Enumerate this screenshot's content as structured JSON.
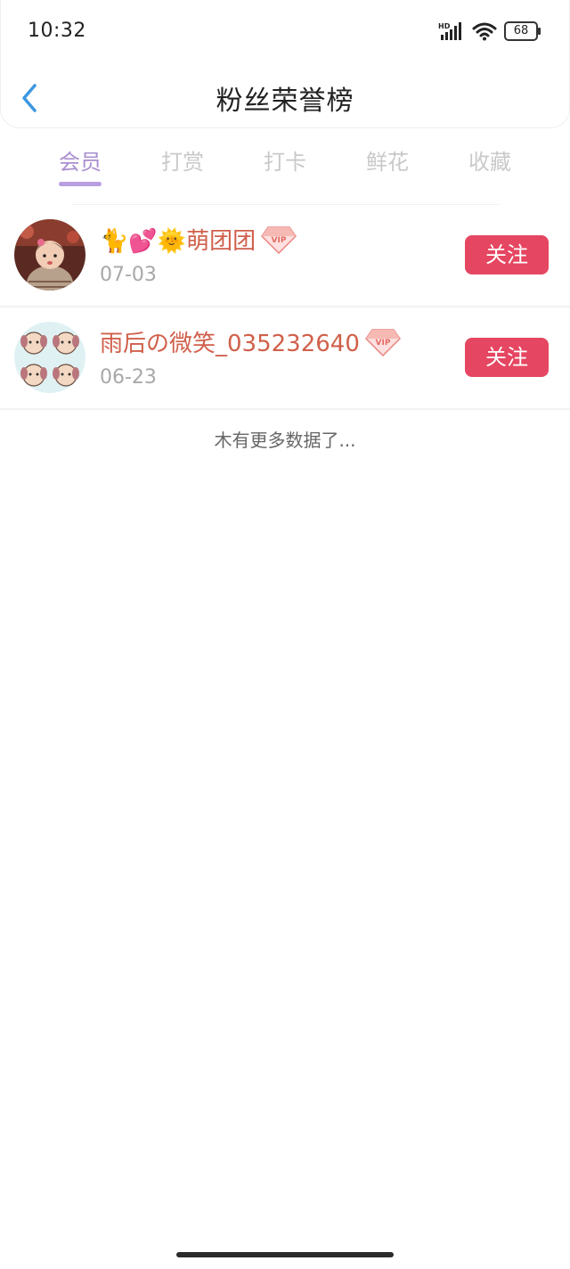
{
  "status_bar": {
    "time": "10:32",
    "network": "HD",
    "battery": "68"
  },
  "header": {
    "title": "粉丝荣誉榜",
    "back_icon": "chevron-left-icon"
  },
  "tabs": [
    {
      "label": "会员",
      "active": true
    },
    {
      "label": "打赏",
      "active": false
    },
    {
      "label": "打卡",
      "active": false
    },
    {
      "label": "鲜花",
      "active": false
    },
    {
      "label": "收藏",
      "active": false
    }
  ],
  "list": [
    {
      "name": "🐈💕🌞萌团团",
      "date": "07-03",
      "badge": "VIP",
      "button": "关注"
    },
    {
      "name": "雨后の微笑_035232640",
      "date": "06-23",
      "badge": "VIP",
      "button": "关注"
    }
  ],
  "footer": {
    "no_more": "木有更多数据了..."
  },
  "colors": {
    "accent": "#a98fcf",
    "follow": "#e54661",
    "name": "#d0604b",
    "back": "#3d97e0"
  }
}
